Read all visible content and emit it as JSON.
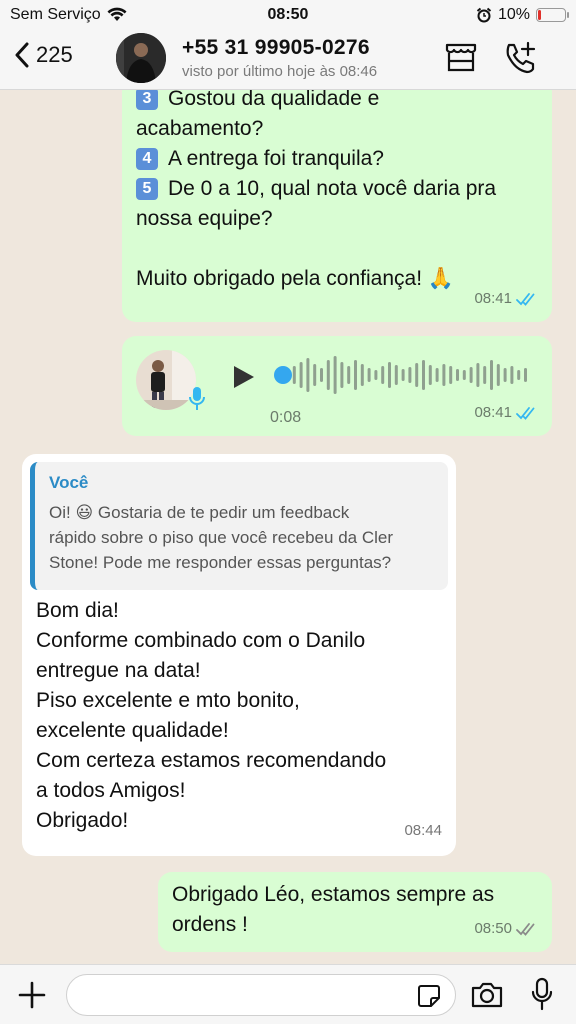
{
  "status": {
    "carrier": "Sem Serviço",
    "time": "08:50",
    "battery": "10%",
    "battery_level": 0.1
  },
  "header": {
    "back_count": "225",
    "contact_name": "+55 31 99905-0276",
    "last_seen": "visto por último hoje às 08:46"
  },
  "messages": {
    "m1": {
      "lines": [
        "3️⃣ Gostou da qualidade e",
        "acabamento?",
        "4️⃣ A entrega foi tranquila?",
        "5️⃣ De 0 a 10, qual nota você daria pra",
        "nossa equipe?",
        "",
        "Muito obrigado pela confiança! 🙏"
      ],
      "q3_num": "3",
      "q3_a": "Gostou da qualidade e",
      "q3_b": "acabamento?",
      "q4_num": "4",
      "q4": "A entrega foi tranquila?",
      "q5_num": "5",
      "q5_a": "De 0 a 10, qual nota você daria pra",
      "q5_b": "nossa equipe?",
      "thanks": "Muito obrigado pela confiança! 🙏",
      "time": "08:41"
    },
    "voice": {
      "duration": "0:08",
      "time": "08:41",
      "progress": 0
    },
    "reply": {
      "quote_author": "Você",
      "quote_text": "Oi! 😃 Gostaria de te pedir um feedback rápido sobre o piso que você recebeu da Cler Stone! Pode me responder essas perguntas?",
      "quote_line1": "Oi! 😃 Gostaria de te pedir um feedback",
      "quote_line2": "rápido sobre o piso que você recebeu da Cler",
      "quote_line3": "Stone! Pode me responder essas perguntas?",
      "lines": [
        "Bom dia!",
        "Conforme combinado com o Danilo",
        "entregue na data!",
        "Piso excelente e mto bonito,",
        "excelente qualidade!",
        "Com certeza estamos recomendando",
        "a todos Amigos!",
        "Obrigado!"
      ],
      "l1": "Bom dia!",
      "l2": "Conforme combinado com o Danilo",
      "l3": "entregue na data!",
      "l4": "Piso excelente e mto bonito,",
      "l5": "excelente qualidade!",
      "l6": "Com certeza estamos recomendando",
      "l7": "a todos Amigos!",
      "l8": "Obrigado!",
      "time": "08:44"
    },
    "m4": {
      "l1": "Obrigado Léo, estamos sempre as",
      "l2": "ordens !",
      "time": "08:50"
    }
  },
  "colors": {
    "outgoing": "#d9fdd3",
    "incoming": "#ffffff",
    "read_ticks": "#34b7f1",
    "quote_accent": "#2b8bc6",
    "background": "#efe7dd"
  },
  "icons": [
    "wifi-icon",
    "alarm-icon",
    "battery-icon",
    "back-chevron-icon",
    "store-icon",
    "call-add-icon",
    "play-icon",
    "mic-icon",
    "double-check-icon",
    "plus-icon",
    "sticker-icon",
    "camera-icon",
    "microphone-icon"
  ]
}
